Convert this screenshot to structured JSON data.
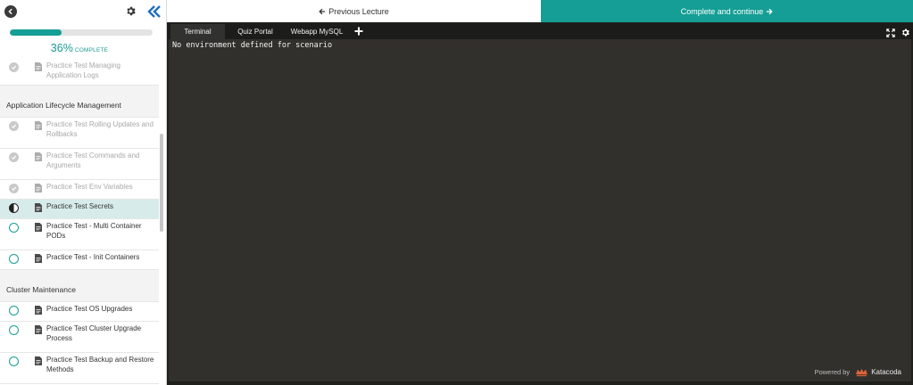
{
  "sidebar": {
    "progress": {
      "percent": 0.36,
      "percent_label": "36%",
      "complete_label": "COMPLETE"
    },
    "groups": [
      {
        "title": "",
        "items": [
          {
            "label": "Practice Test Managing Application Logs",
            "state": "done"
          }
        ]
      },
      {
        "title": "Application Lifecycle Management",
        "items": [
          {
            "label": "Practice Test Rolling Updates and Rollbacks",
            "state": "done"
          },
          {
            "label": "Practice Test Commands and Arguments",
            "state": "done"
          },
          {
            "label": "Practice Test Env Variables",
            "state": "done"
          },
          {
            "label": "Practice Test Secrets",
            "state": "active"
          },
          {
            "label": "Practice Test - Multi Container PODs",
            "state": "todo"
          },
          {
            "label": "Practice Test - Init Containers",
            "state": "todo"
          }
        ]
      },
      {
        "title": "Cluster Maintenance",
        "items": [
          {
            "label": "Practice Test OS Upgrades",
            "state": "todo"
          },
          {
            "label": "Practice Test Cluster Upgrade Process",
            "state": "todo"
          },
          {
            "label": "Practice Test Backup and Restore Methods",
            "state": "todo"
          }
        ]
      }
    ]
  },
  "nav": {
    "prev_label": "Previous Lecture",
    "next_label": "Complete and continue"
  },
  "terminal": {
    "tabs": [
      "Terminal",
      "Quiz Portal",
      "Webapp MySQL"
    ],
    "active_tab": "Terminal",
    "output": "No environment defined for scenario",
    "powered_by": "Powered by",
    "brand": "Katacoda"
  },
  "colors": {
    "accent": "#159e95",
    "terminal_bg": "#32302c",
    "active_item_bg": "#d7ecea"
  }
}
